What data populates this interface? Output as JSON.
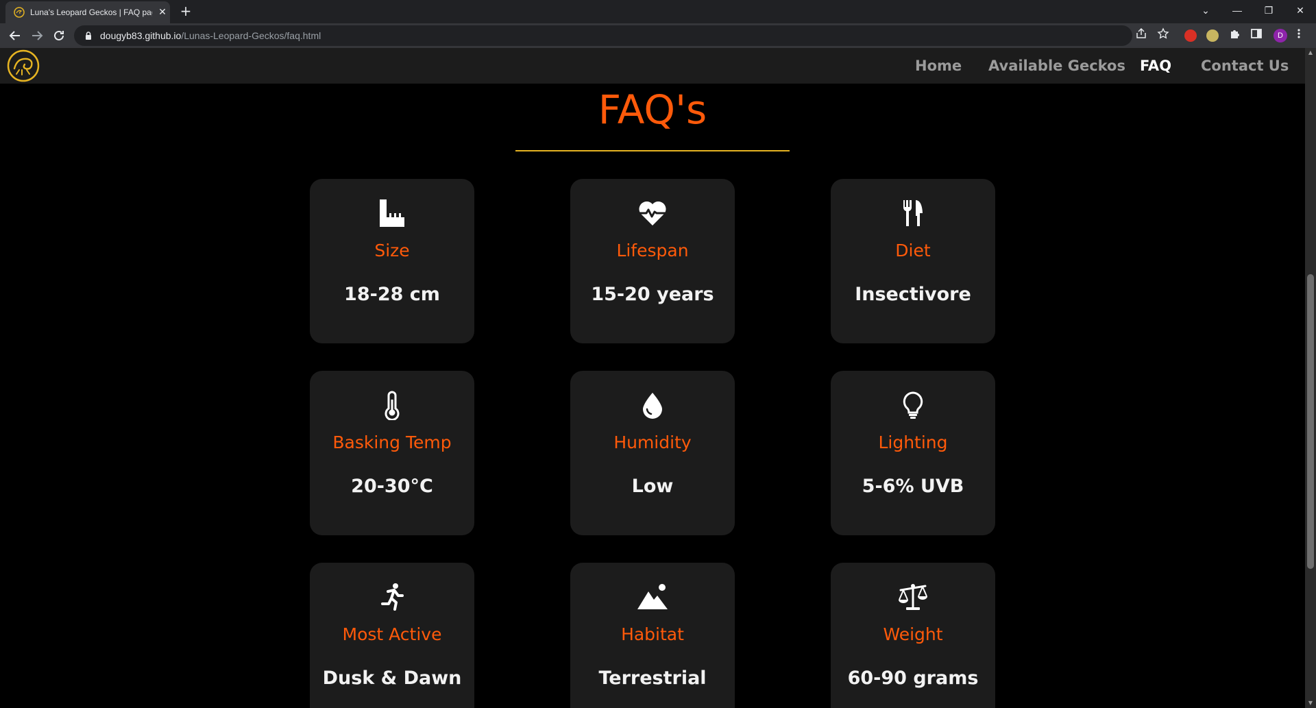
{
  "browser": {
    "tab_title": "Luna's Leopard Geckos | FAQ page",
    "tab_close_glyph": "✕",
    "new_tab_glyph": "+",
    "url_host": "dougyb83.github.io",
    "url_path": "/Lunas-Leopard-Geckos/faq.html",
    "profile_initial": "D",
    "window_controls": [
      "⌄",
      "—",
      "❐",
      "✕"
    ]
  },
  "nav": {
    "links": [
      "Home",
      "Available Geckos",
      "FAQ",
      "Contact Us"
    ],
    "active": "FAQ"
  },
  "page": {
    "heading": "FAQ's",
    "accent_color": "#ff5a0a",
    "rule_color": "#e6b422"
  },
  "faq": [
    {
      "icon": "ruler-icon",
      "label": "Size",
      "value": "18-28 cm"
    },
    {
      "icon": "heart-pulse-icon",
      "label": "Lifespan",
      "value": "15-20 years"
    },
    {
      "icon": "utensils-icon",
      "label": "Diet",
      "value": "Insectivore"
    },
    {
      "icon": "thermometer-icon",
      "label": "Basking Temp",
      "value": "20-30°C"
    },
    {
      "icon": "droplet-icon",
      "label": "Humidity",
      "value": "Low"
    },
    {
      "icon": "lightbulb-icon",
      "label": "Lighting",
      "value": "5-6% UVB"
    },
    {
      "icon": "running-person-icon",
      "label": "Most Active",
      "value": "Dusk & Dawn"
    },
    {
      "icon": "mountain-icon",
      "label": "Habitat",
      "value": "Terrestrial"
    },
    {
      "icon": "scale-icon",
      "label": "Weight",
      "value": "60-90 grams"
    }
  ]
}
